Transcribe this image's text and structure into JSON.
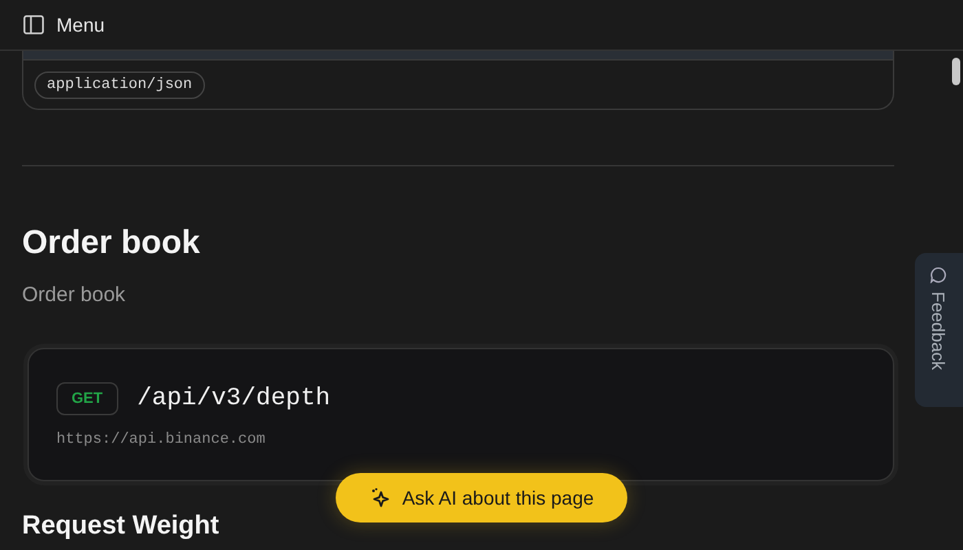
{
  "topbar": {
    "menu_label": "Menu"
  },
  "content_type_chip": "application/json",
  "section": {
    "title": "Order book",
    "description": "Order book"
  },
  "endpoint": {
    "method": "GET",
    "path": "/api/v3/depth",
    "base_url": "https://api.binance.com"
  },
  "next_heading": "Request Weight",
  "ask_ai_button": "Ask AI about this page",
  "feedback_tab": "Feedback"
}
